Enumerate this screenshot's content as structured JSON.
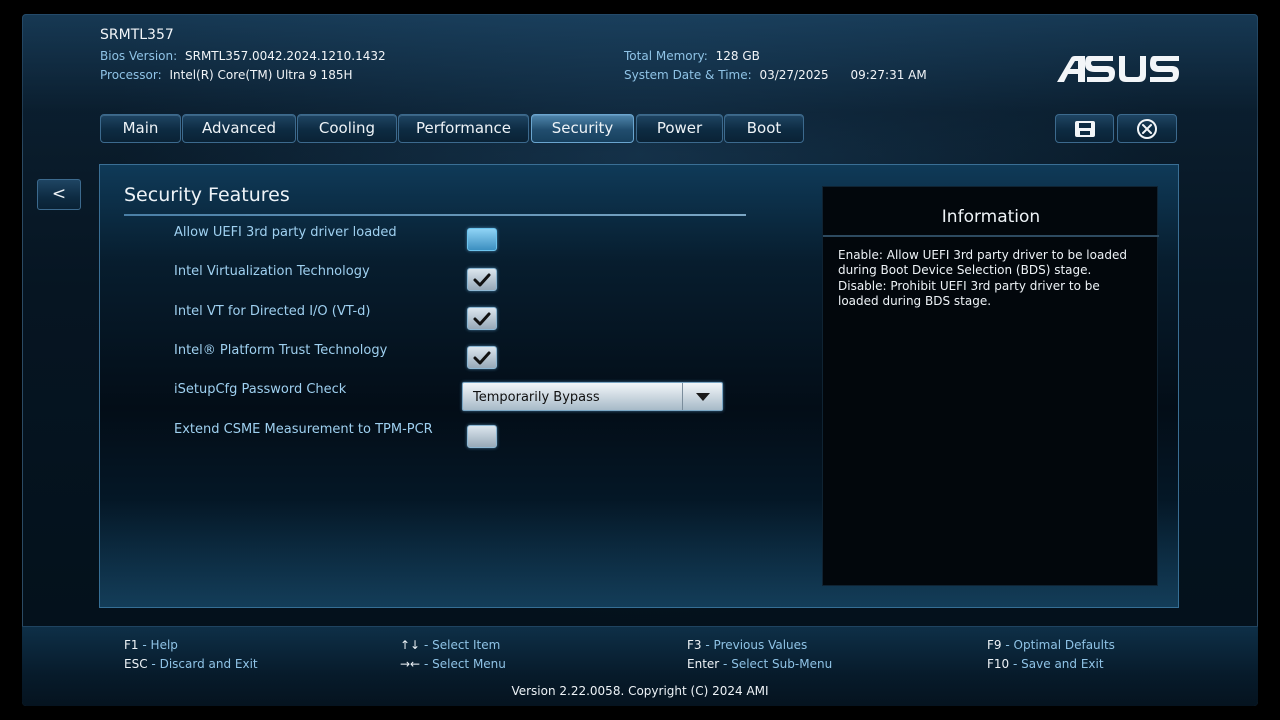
{
  "header": {
    "model": "SRMTL357",
    "bios_version_label": "Bios Version:",
    "bios_version": "SRMTL357.0042.2024.1210.1432",
    "processor_label": "Processor:",
    "processor": "Intel(R) Core(TM) Ultra 9 185H",
    "memory_label": "Total Memory:",
    "memory": "128 GB",
    "datetime_label": "System Date & Time:",
    "date": "03/27/2025",
    "time": "09:27:31 AM",
    "logo_text": "ASUS",
    "logo_icon": "asus-logo"
  },
  "tabs": [
    {
      "label": "Main",
      "active": false
    },
    {
      "label": "Advanced",
      "active": false
    },
    {
      "label": "Cooling",
      "active": false
    },
    {
      "label": "Performance",
      "active": false
    },
    {
      "label": "Security",
      "active": true
    },
    {
      "label": "Power",
      "active": false
    },
    {
      "label": "Boot",
      "active": false
    }
  ],
  "actions": {
    "save_icon": "floppy-disk-icon",
    "exit_icon": "close-circle-icon"
  },
  "back_button": "<",
  "section": {
    "title": "Security Features",
    "items": [
      {
        "label": "Allow UEFI 3rd party driver loaded",
        "type": "checkbox",
        "checked": false,
        "focused": true
      },
      {
        "label": "Intel Virtualization Technology",
        "type": "checkbox",
        "checked": true
      },
      {
        "label": "Intel VT for Directed I/O (VT-d)",
        "type": "checkbox",
        "checked": true
      },
      {
        "label": "Intel® Platform Trust Technology",
        "type": "checkbox",
        "checked": true
      },
      {
        "label": "iSetupCfg Password Check",
        "type": "select",
        "value": "Temporarily Bypass"
      },
      {
        "label": "Extend CSME Measurement to TPM-PCR",
        "type": "checkbox",
        "checked": false
      }
    ]
  },
  "information": {
    "title": "Information",
    "text": "Enable: Allow UEFI 3rd party driver to be loaded\nduring Boot Device Selection (BDS) stage.\nDisable: Prohibit UEFI 3rd party driver to be\nloaded during BDS stage."
  },
  "footer": {
    "hotkeys": [
      {
        "key": "F1",
        "action": "Help"
      },
      {
        "key": "ESC",
        "action": "Discard and Exit"
      },
      {
        "key": "↑↓",
        "action": "Select Item"
      },
      {
        "key": "→←",
        "action": "Select Menu"
      },
      {
        "key": "F3",
        "action": "Previous Values"
      },
      {
        "key": "Enter",
        "action": "Select Sub-Menu"
      },
      {
        "key": "F9",
        "action": "Optimal Defaults"
      },
      {
        "key": "F10",
        "action": "Save and Exit"
      }
    ],
    "separator": "-",
    "version": "Version 2.22.0058. Copyright (C) 2024 AMI"
  },
  "colors": {
    "accent": "#8fc3e6",
    "active_tab": "#4f86ad",
    "background": "#03101a"
  }
}
